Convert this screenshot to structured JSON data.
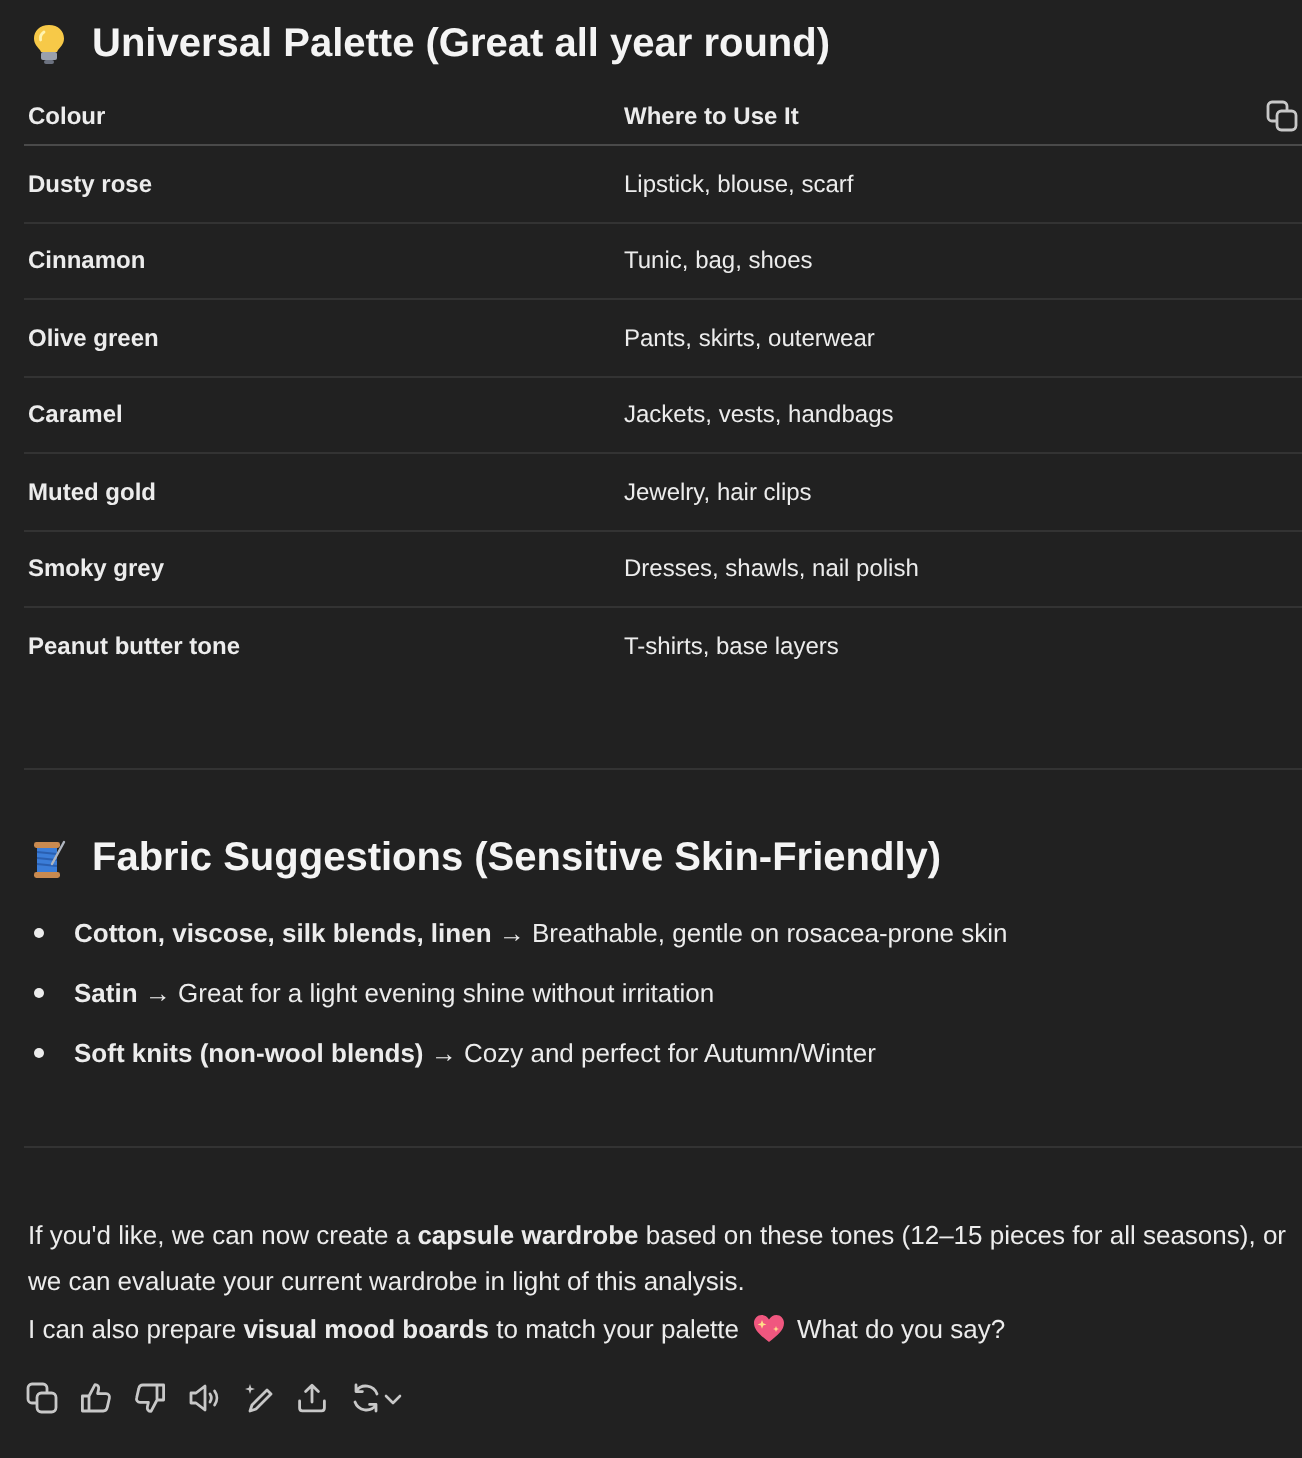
{
  "palette": {
    "title": "Universal Palette (Great all year round)",
    "columns": [
      "Colour",
      "Where to Use It"
    ],
    "rows": [
      {
        "colour": "Dusty rose",
        "where_to_use": "Lipstick, blouse, scarf"
      },
      {
        "colour": "Cinnamon",
        "where_to_use": "Tunic, bag, shoes"
      },
      {
        "colour": "Olive green",
        "where_to_use": "Pants, skirts, outerwear"
      },
      {
        "colour": "Caramel",
        "where_to_use": "Jackets, vests, handbags"
      },
      {
        "colour": "Muted gold",
        "where_to_use": "Jewelry, hair clips"
      },
      {
        "colour": "Smoky grey",
        "where_to_use": "Dresses, shawls, nail polish"
      },
      {
        "colour": "Peanut butter tone",
        "where_to_use": "T-shirts, base layers"
      }
    ]
  },
  "fabrics": {
    "title": "Fabric Suggestions (Sensitive Skin-Friendly)",
    "items": [
      "**Cotton, viscose, silk blends, linen** → Breathable, gentle on rosacea-prone skin",
      "**Satin** → Great for a light evening shine without irritation",
      "**Soft knits (non-wool blends)** → Cozy and perfect for Autumn/Winter"
    ]
  },
  "closing": {
    "paragraph": "If you'd like, we can now create a **capsule wardrobe** based on these tones (12–15 pieces for all seasons), or we can evaluate your current wardrobe in light of this analysis.",
    "line_before_icon": "I can also prepare **visual mood boards** to match your palette",
    "line_after_icon": "What do you say?"
  }
}
